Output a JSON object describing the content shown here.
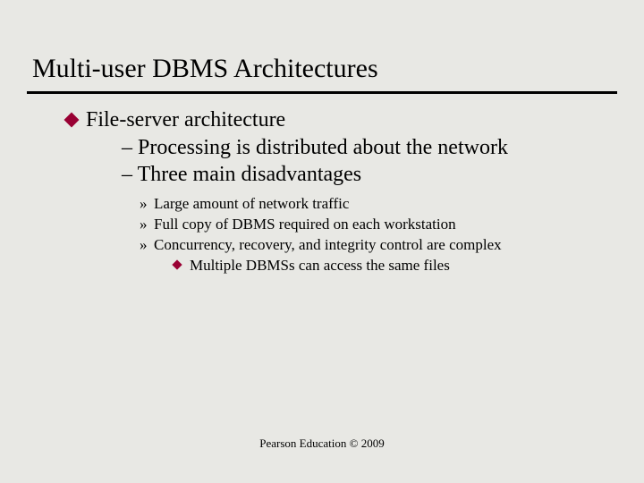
{
  "title": "Multi-user DBMS Architectures",
  "b1": "File-server architecture",
  "b2a": "– Processing is distributed about the network",
  "b2b": "– Three main disadvantages",
  "b3a": "Large amount of network traffic",
  "b3b": "Full copy of DBMS required on each workstation",
  "b3c": "Concurrency, recovery, and integrity control are complex",
  "b4a": "Multiple DBMSs can access the same files",
  "footer": "Pearson Education © 2009"
}
